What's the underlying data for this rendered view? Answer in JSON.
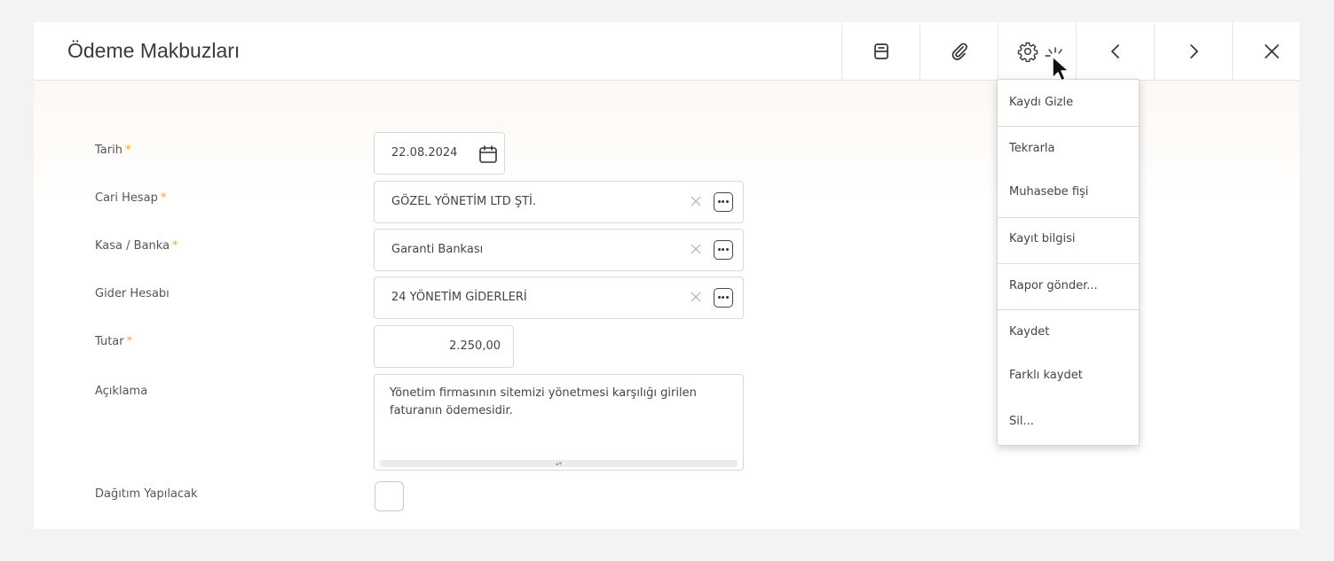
{
  "header": {
    "title": "Ödeme Makbuzları",
    "toolbar": [
      {
        "icon": "print-icon"
      },
      {
        "icon": "paperclip-icon"
      },
      {
        "icon": "gear-icon"
      },
      {
        "icon": "chevron-left-icon"
      },
      {
        "icon": "chevron-right-icon"
      },
      {
        "icon": "close-icon"
      }
    ]
  },
  "form": {
    "date": {
      "label": "Tarih",
      "required_mark": "*",
      "value": "22.08.2024"
    },
    "account": {
      "label": "Cari Hesap",
      "required_mark": "*",
      "value": "GÖZEL YÖNETİM LTD ŞTİ."
    },
    "cash_bank": {
      "label": "Kasa / Banka",
      "required_mark": "*",
      "value": "Garanti Bankası"
    },
    "expense_account": {
      "label": "Gider Hesabı",
      "value": "24 YÖNETİM GİDERLERİ"
    },
    "amount": {
      "label": "Tutar",
      "required_mark": "*",
      "value": "2.250,00"
    },
    "description": {
      "label": "Açıklama",
      "value": "Yönetim firmasının sitemizi yönetmesi karşılığı girilen faturanın ödemesidir."
    },
    "distribution": {
      "label": "Dağıtım Yapılacak",
      "checked": false
    }
  },
  "dropdown": {
    "items": [
      "Kaydı Gizle",
      "Tekrarla",
      "Muhasebe fişi",
      "Kayıt bilgisi",
      "Rapor gönder...",
      "Kaydet",
      "Farklı kaydet",
      "Sil..."
    ]
  },
  "colors": {
    "required": "#f5a623",
    "border": "#d9d9dc",
    "background": "#f3f3f4"
  }
}
